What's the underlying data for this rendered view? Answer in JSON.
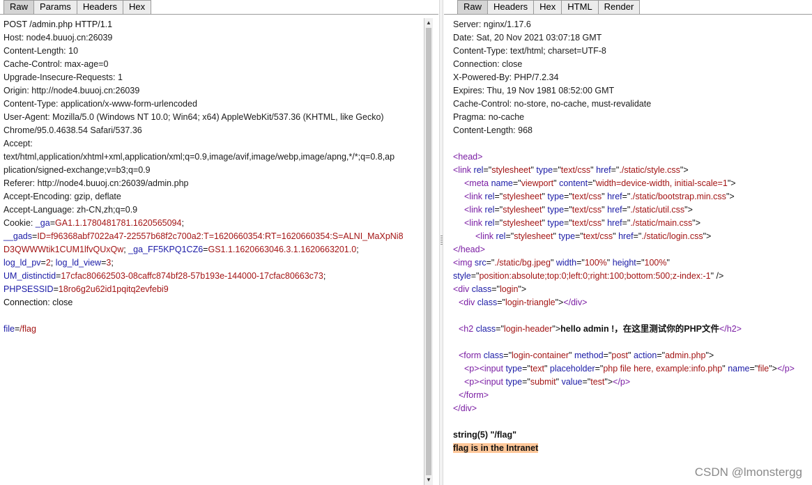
{
  "left": {
    "tabs": [
      "Raw",
      "Params",
      "Headers",
      "Hex"
    ],
    "active_tab": "Raw",
    "request_line": "POST /admin.php HTTP/1.1",
    "headers": [
      "Host: node4.buuoj.cn:26039",
      "Content-Length: 10",
      "Cache-Control: max-age=0",
      "Upgrade-Insecure-Requests: 1",
      "Origin: http://node4.buuoj.cn:26039",
      "Content-Type: application/x-www-form-urlencoded",
      "User-Agent: Mozilla/5.0 (Windows NT 10.0; Win64; x64) AppleWebKit/537.36 (KHTML, like Gecko)",
      "Chrome/95.0.4638.54 Safari/537.36",
      "Accept:",
      "text/html,application/xhtml+xml,application/xml;q=0.9,image/avif,image/webp,image/apng,*/*;q=0.8,ap",
      "plication/signed-exchange;v=b3;q=0.9",
      "Referer: http://node4.buuoj.cn:26039/admin.php",
      "Accept-Encoding: gzip, deflate",
      "Accept-Language: zh-CN,zh;q=0.9"
    ],
    "cookie_label": "Cookie: ",
    "cookie_lines": [
      [
        {
          "n": "_ga",
          "v": "GA1.1.1780481781.1620565094"
        },
        {
          "s": ";"
        }
      ],
      [
        {
          "n": "__gads",
          "v": "ID=f96368abf7022a47-22557b68f2c700a2:T=1620660354:RT=1620660354:S=ALNI_MaXpNi8"
        }
      ],
      [
        {
          "v": "D3QWWWtik1CUM1lfvQUxQw"
        },
        {
          "s": "; "
        },
        {
          "n": "_ga_FF5KPQ1CZ6",
          "v": "GS1.1.1620663046.3.1.1620663201.0"
        },
        {
          "s": ";"
        }
      ],
      [
        {
          "n": "log_ld_pv",
          "v": "2"
        },
        {
          "s": "; "
        },
        {
          "n": "log_ld_view",
          "v": "3"
        },
        {
          "s": ";"
        }
      ],
      [
        {
          "n": "UM_distinctid",
          "v": "17cfac80662503-08caffc874bf28-57b193e-144000-17cfac80663c73"
        },
        {
          "s": ";"
        }
      ],
      [
        {
          "n": "PHPSESSID",
          "v": "18ro6g2u62id1pqitq2evfebi9"
        }
      ]
    ],
    "connection": "Connection: close",
    "body_param": {
      "n": "file",
      "v": "/flag"
    }
  },
  "right": {
    "tabs": [
      "Raw",
      "Headers",
      "Hex",
      "HTML",
      "Render"
    ],
    "active_tab": "Raw",
    "headers": [
      "Server: nginx/1.17.6",
      "Date: Sat, 20 Nov 2021 03:07:18 GMT",
      "Content-Type: text/html; charset=UTF-8",
      "Connection: close",
      "X-Powered-By: PHP/7.2.34",
      "Expires: Thu, 19 Nov 1981 08:52:00 GMT",
      "Cache-Control: no-store, no-cache, must-revalidate",
      "Pragma: no-cache",
      "Content-Length: 968"
    ],
    "html_lines": [
      {
        "indent": 0,
        "parts": [
          [
            "tag",
            "<head>"
          ]
        ]
      },
      {
        "indent": 0,
        "parts": [
          [
            "tag",
            "<link "
          ],
          [
            "attr",
            "rel"
          ],
          [
            "txt",
            "=\""
          ],
          [
            "aval",
            "stylesheet"
          ],
          [
            "txt",
            "\" "
          ],
          [
            "attr",
            "type"
          ],
          [
            "txt",
            "=\""
          ],
          [
            "aval",
            "text/css"
          ],
          [
            "txt",
            "\" "
          ],
          [
            "attr",
            "href"
          ],
          [
            "txt",
            "=\""
          ],
          [
            "aval",
            "./static/style.css"
          ],
          [
            "txt",
            "\">"
          ]
        ]
      },
      {
        "indent": 1,
        "parts": [
          [
            "tag",
            "<meta "
          ],
          [
            "attr",
            "name"
          ],
          [
            "txt",
            "=\""
          ],
          [
            "aval",
            "viewport"
          ],
          [
            "txt",
            "\" "
          ],
          [
            "attr",
            "content"
          ],
          [
            "txt",
            "=\""
          ],
          [
            "aval",
            "width=device-width, initial-scale=1"
          ],
          [
            "txt",
            "\">"
          ]
        ]
      },
      {
        "indent": 1,
        "parts": [
          [
            "tag",
            "<link "
          ],
          [
            "attr",
            "rel"
          ],
          [
            "txt",
            "=\""
          ],
          [
            "aval",
            "stylesheet"
          ],
          [
            "txt",
            "\" "
          ],
          [
            "attr",
            "type"
          ],
          [
            "txt",
            "=\""
          ],
          [
            "aval",
            "text/css"
          ],
          [
            "txt",
            "\" "
          ],
          [
            "attr",
            "href"
          ],
          [
            "txt",
            "=\""
          ],
          [
            "aval",
            "./static/bootstrap.min.css"
          ],
          [
            "txt",
            "\">"
          ]
        ]
      },
      {
        "indent": 1,
        "parts": [
          [
            "tag",
            "<link "
          ],
          [
            "attr",
            "rel"
          ],
          [
            "txt",
            "=\""
          ],
          [
            "aval",
            "stylesheet"
          ],
          [
            "txt",
            "\" "
          ],
          [
            "attr",
            "type"
          ],
          [
            "txt",
            "=\""
          ],
          [
            "aval",
            "text/css"
          ],
          [
            "txt",
            "\" "
          ],
          [
            "attr",
            "href"
          ],
          [
            "txt",
            "=\""
          ],
          [
            "aval",
            "./static/util.css"
          ],
          [
            "txt",
            "\">"
          ]
        ]
      },
      {
        "indent": 1,
        "parts": [
          [
            "tag",
            "<link "
          ],
          [
            "attr",
            "rel"
          ],
          [
            "txt",
            "=\""
          ],
          [
            "aval",
            "stylesheet"
          ],
          [
            "txt",
            "\" "
          ],
          [
            "attr",
            "type"
          ],
          [
            "txt",
            "=\""
          ],
          [
            "aval",
            "text/css"
          ],
          [
            "txt",
            "\" "
          ],
          [
            "attr",
            "href"
          ],
          [
            "txt",
            "=\""
          ],
          [
            "aval",
            "./static/main.css"
          ],
          [
            "txt",
            "\">"
          ]
        ]
      },
      {
        "indent": 2,
        "parts": [
          [
            "tag",
            "<link "
          ],
          [
            "attr",
            "rel"
          ],
          [
            "txt",
            "=\""
          ],
          [
            "aval",
            "stylesheet"
          ],
          [
            "txt",
            "\" "
          ],
          [
            "attr",
            "type"
          ],
          [
            "txt",
            "=\""
          ],
          [
            "aval",
            "text/css"
          ],
          [
            "txt",
            "\" "
          ],
          [
            "attr",
            "href"
          ],
          [
            "txt",
            "=\""
          ],
          [
            "aval",
            "./static/login.css"
          ],
          [
            "txt",
            "\">"
          ]
        ]
      },
      {
        "indent": 0,
        "parts": [
          [
            "tag",
            "</head>"
          ]
        ]
      },
      {
        "indent": 0,
        "parts": [
          [
            "tag",
            "<img "
          ],
          [
            "attr",
            "src"
          ],
          [
            "txt",
            "=\""
          ],
          [
            "aval",
            "./static/bg.jpeg"
          ],
          [
            "txt",
            "\" "
          ],
          [
            "attr",
            "width"
          ],
          [
            "txt",
            "=\""
          ],
          [
            "aval",
            "100%"
          ],
          [
            "txt",
            "\" "
          ],
          [
            "attr",
            "height"
          ],
          [
            "txt",
            "=\""
          ],
          [
            "aval",
            "100%"
          ],
          [
            "txt",
            "\""
          ]
        ]
      },
      {
        "indent": 0,
        "parts": [
          [
            "attr",
            "style"
          ],
          [
            "txt",
            "=\""
          ],
          [
            "aval",
            "position:absolute;top:0;left:0;right:100;bottom:500;z-index:-1"
          ],
          [
            "txt",
            "\" />"
          ]
        ]
      },
      {
        "indent": 0,
        "parts": [
          [
            "tag",
            "<div "
          ],
          [
            "attr",
            "class"
          ],
          [
            "txt",
            "=\""
          ],
          [
            "aval",
            "login"
          ],
          [
            "txt",
            "\">"
          ]
        ]
      },
      {
        "indent": 0.5,
        "parts": [
          [
            "tag",
            "<div "
          ],
          [
            "attr",
            "class"
          ],
          [
            "txt",
            "=\""
          ],
          [
            "aval",
            "login-triangle"
          ],
          [
            "txt",
            "\">"
          ],
          [
            "tag",
            "</div>"
          ]
        ]
      },
      {
        "indent": 0,
        "parts": []
      },
      {
        "indent": 0.5,
        "parts": [
          [
            "tag",
            "<h2 "
          ],
          [
            "attr",
            "class"
          ],
          [
            "txt",
            "=\""
          ],
          [
            "aval",
            "login-header"
          ],
          [
            "txt",
            "\">"
          ],
          [
            "bold",
            "hello admin !，在这里测试你的PHP文件"
          ],
          [
            "tag",
            "</h2>"
          ]
        ]
      },
      {
        "indent": 0,
        "parts": []
      },
      {
        "indent": 0.5,
        "parts": [
          [
            "tag",
            "<form "
          ],
          [
            "attr",
            "class"
          ],
          [
            "txt",
            "=\""
          ],
          [
            "aval",
            "login-container"
          ],
          [
            "txt",
            "\" "
          ],
          [
            "attr",
            "method"
          ],
          [
            "txt",
            "=\""
          ],
          [
            "aval",
            "post"
          ],
          [
            "txt",
            "\" "
          ],
          [
            "attr",
            "action"
          ],
          [
            "txt",
            "=\""
          ],
          [
            "aval",
            "admin.php"
          ],
          [
            "txt",
            "\">"
          ]
        ]
      },
      {
        "indent": 1,
        "parts": [
          [
            "tag",
            "<p>"
          ],
          [
            "tag",
            "<input "
          ],
          [
            "attr",
            "type"
          ],
          [
            "txt",
            "=\""
          ],
          [
            "aval",
            "text"
          ],
          [
            "txt",
            "\" "
          ],
          [
            "attr",
            "placeholder"
          ],
          [
            "txt",
            "=\""
          ],
          [
            "aval",
            "php file here, example:info.php"
          ],
          [
            "txt",
            "\" "
          ],
          [
            "attr",
            "name"
          ],
          [
            "txt",
            "=\""
          ],
          [
            "aval",
            "file"
          ],
          [
            "txt",
            "\">"
          ],
          [
            "tag",
            "</p>"
          ]
        ]
      },
      {
        "indent": 1,
        "parts": [
          [
            "tag",
            "<p>"
          ],
          [
            "tag",
            "<input "
          ],
          [
            "attr",
            "type"
          ],
          [
            "txt",
            "=\""
          ],
          [
            "aval",
            "submit"
          ],
          [
            "txt",
            "\" "
          ],
          [
            "attr",
            "value"
          ],
          [
            "txt",
            "=\""
          ],
          [
            "aval",
            "test"
          ],
          [
            "txt",
            "\">"
          ],
          [
            "tag",
            "</p>"
          ]
        ]
      },
      {
        "indent": 0.5,
        "parts": [
          [
            "tag",
            "</form>"
          ]
        ]
      },
      {
        "indent": 0,
        "parts": [
          [
            "tag",
            "</div>"
          ]
        ]
      }
    ],
    "output_line1": "string(5) \"/flag\"",
    "output_line2": "flag is in the Intranet"
  },
  "watermark": "CSDN @lmonstergg"
}
